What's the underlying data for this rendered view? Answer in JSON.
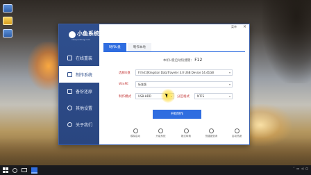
{
  "app": {
    "brand_title": "小鱼系统",
    "brand_url": "xiaoyuxitong.com",
    "menu_label": "菜单",
    "close_label": "×"
  },
  "sidebar": {
    "items": [
      {
        "label": "在线重装",
        "icon": "monitor-icon",
        "active": false
      },
      {
        "label": "制作系统",
        "icon": "usb-icon",
        "active": true
      },
      {
        "label": "备份还原",
        "icon": "backup-icon",
        "active": false
      },
      {
        "label": "其他设置",
        "icon": "settings-icon",
        "active": false
      },
      {
        "label": "关于我们",
        "icon": "info-icon",
        "active": false
      }
    ]
  },
  "tabs": [
    {
      "label": "制作U盘",
      "active": true
    },
    {
      "label": "制作本地",
      "active": false
    }
  ],
  "hint": {
    "text": "本机U盘启动快捷键：",
    "key": "F12"
  },
  "form": {
    "usb_label": "选择U盘",
    "usb_value": "F:[hd1]Kingston DataTraveler 3.0 USB Device 14.41GB",
    "winpe_label": "WinPE",
    "winpe_value": "标准版",
    "mode_label": "制作模式",
    "mode_value": "USB-HDD",
    "fs_label": "分区格式",
    "fs_value": "NTFS"
  },
  "start_button": "开始制作",
  "tools": [
    {
      "label": "模拟启动",
      "icon": "play-icon"
    },
    {
      "label": "升级系统",
      "icon": "upgrade-icon"
    },
    {
      "label": "格式转换",
      "icon": "convert-icon"
    },
    {
      "label": "快捷键查询",
      "icon": "search-icon"
    },
    {
      "label": "启动热键",
      "icon": "keyboard-icon"
    }
  ],
  "taskbar": {
    "time": "",
    "date": ""
  },
  "colors": {
    "sidebar_bg": "#2f4f8e",
    "accent": "#2f6de0",
    "label_red": "#c43a3a"
  }
}
